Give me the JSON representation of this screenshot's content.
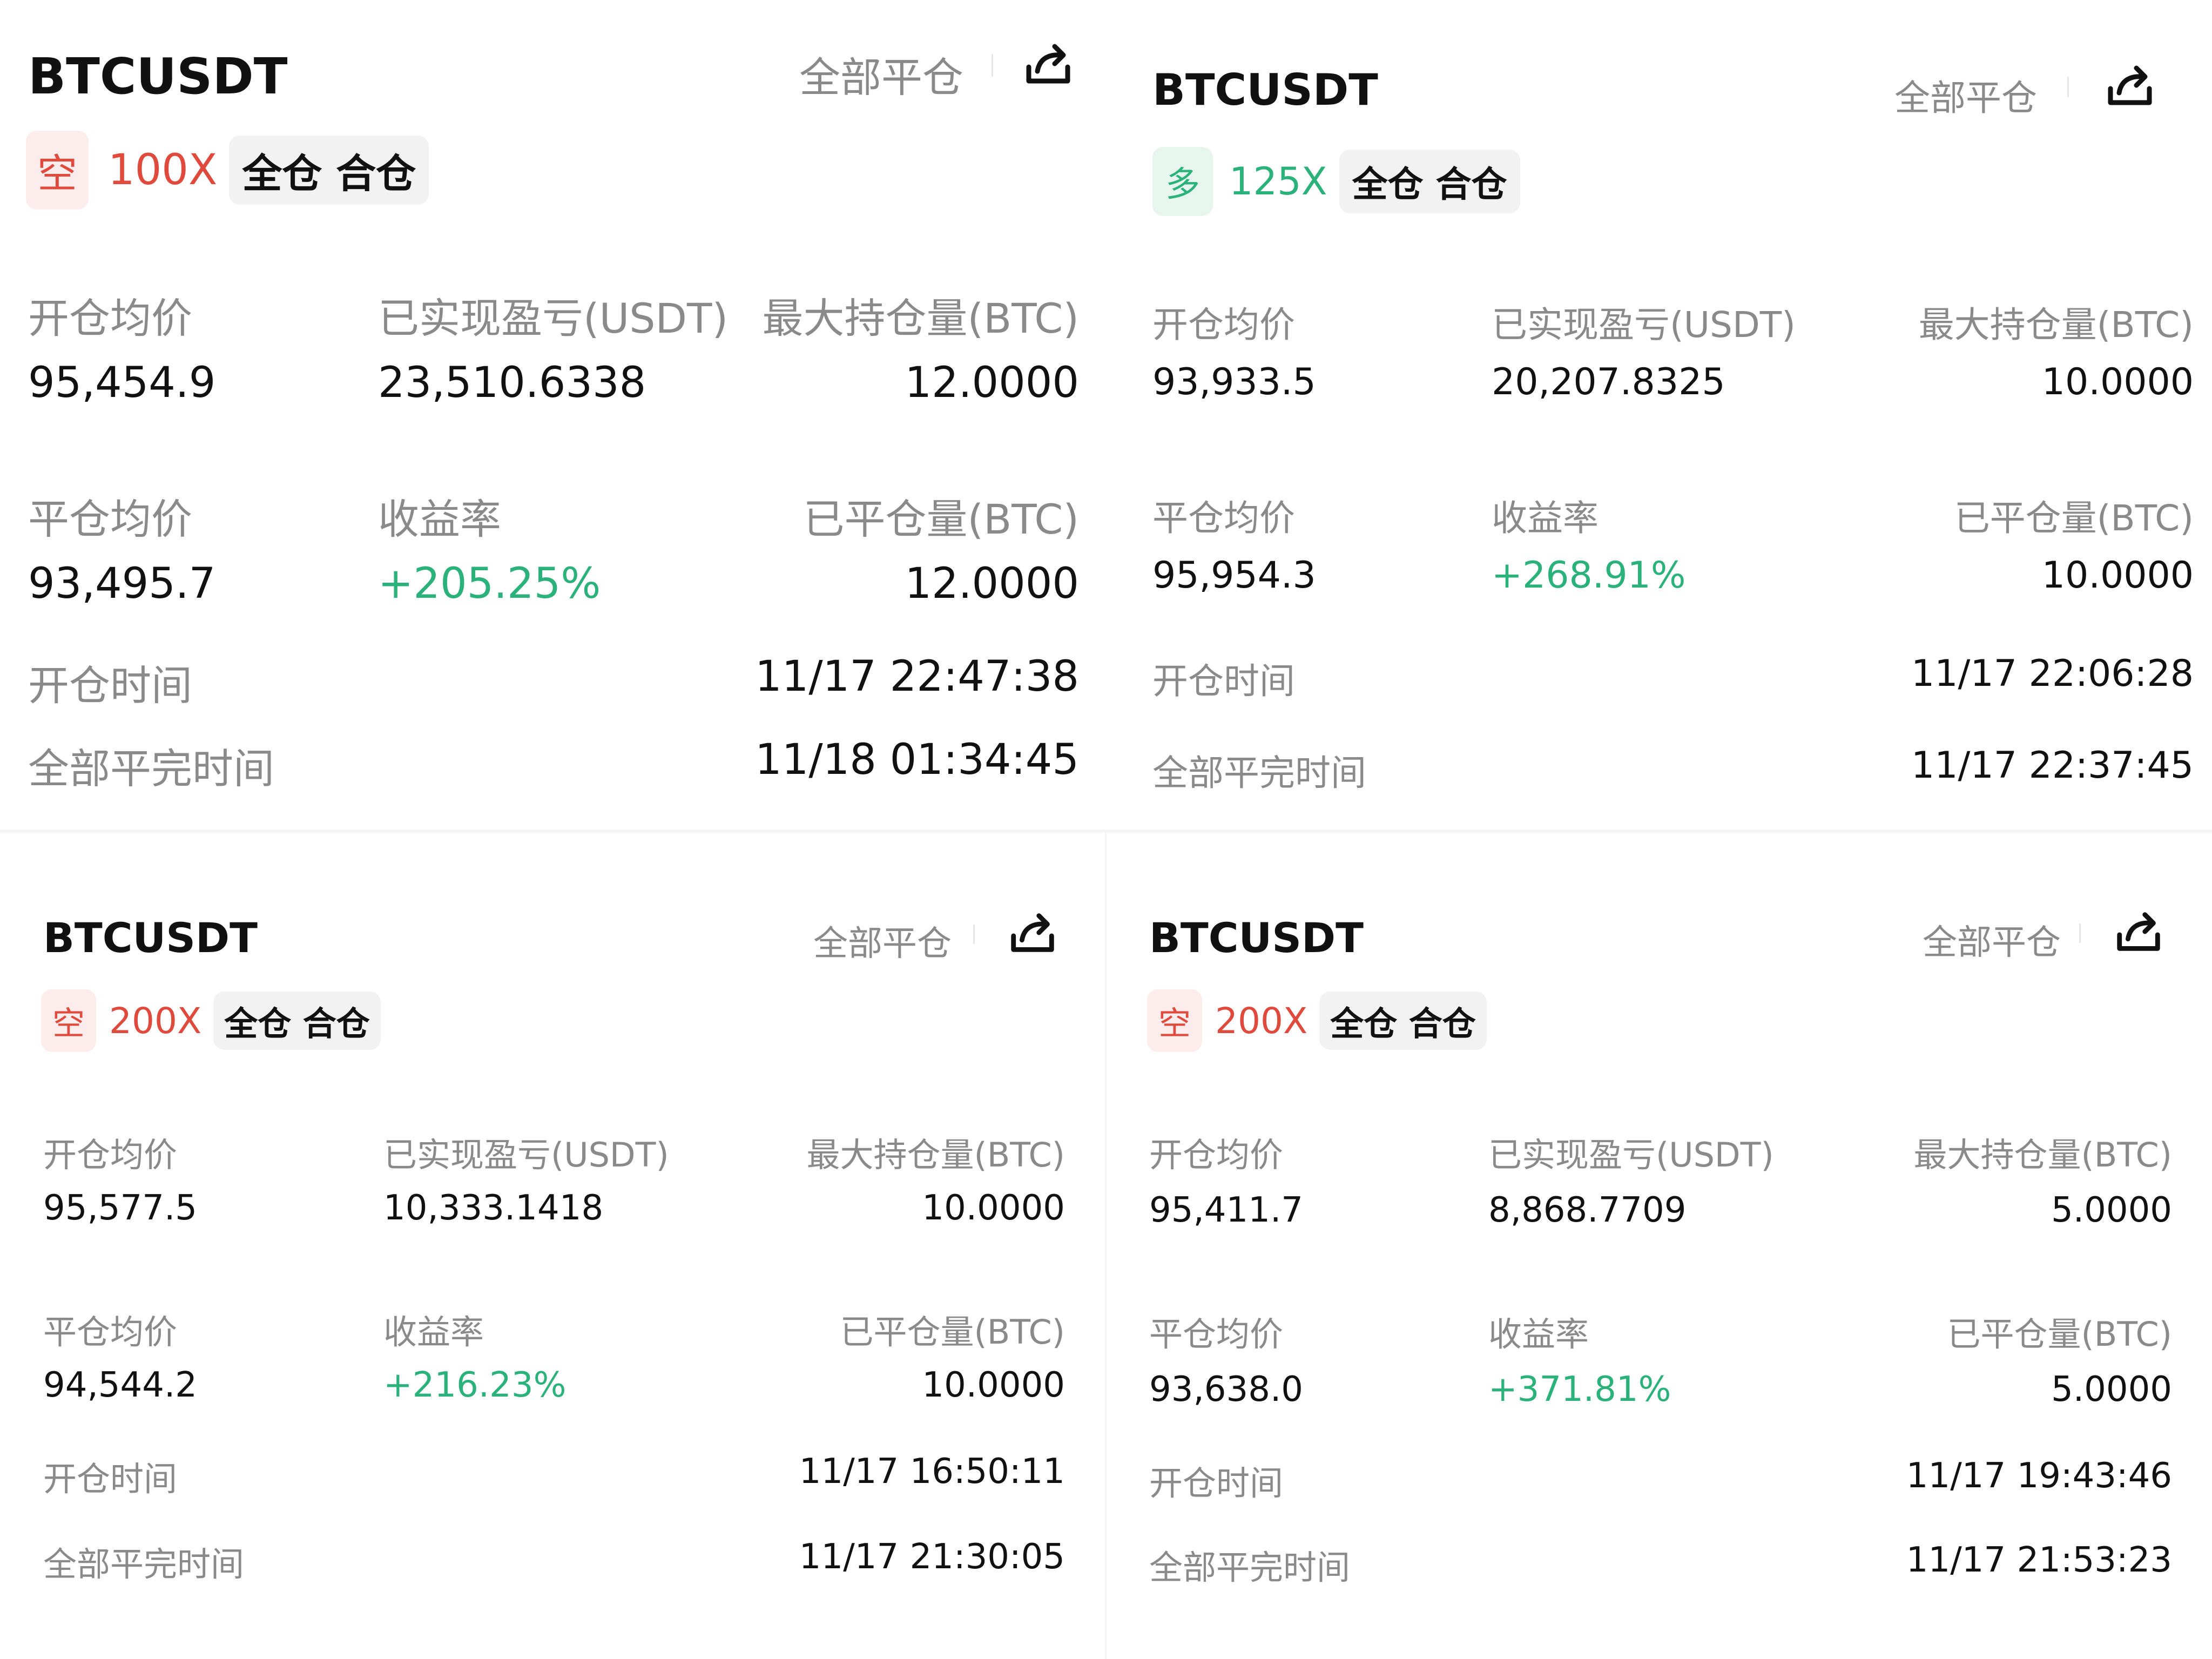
{
  "labels": {
    "open_avg": "开仓均价",
    "realized_pnl": "已实现盈亏(USDT)",
    "max_position": "最大持仓量(BTC)",
    "close_avg": "平仓均价",
    "yield": "收益率",
    "closed_qty": "已平仓量(BTC)",
    "open_time": "开仓时间",
    "full_close_time": "全部平完时间"
  },
  "cards": [
    {
      "symbol": "BTCUSDT",
      "close_all": "全部平仓",
      "side": "空",
      "side_type": "short",
      "leverage": "100X",
      "margin_mode": "全仓 合仓",
      "open_avg": "95,454.9",
      "realized_pnl": "23,510.6338",
      "max_position": "12.0000",
      "close_avg": "93,495.7",
      "yield": "+205.25%",
      "closed_qty": "12.0000",
      "open_time": "11/17 22:47:38",
      "full_close_time": "11/18 01:34:45"
    },
    {
      "symbol": "BTCUSDT",
      "close_all": "全部平仓",
      "side": "多",
      "side_type": "long",
      "leverage": "125X",
      "margin_mode": "全仓 合仓",
      "open_avg": "93,933.5",
      "realized_pnl": "20,207.8325",
      "max_position": "10.0000",
      "close_avg": "95,954.3",
      "yield": "+268.91%",
      "closed_qty": "10.0000",
      "open_time": "11/17 22:06:28",
      "full_close_time": "11/17 22:37:45"
    },
    {
      "symbol": "BTCUSDT",
      "close_all": "全部平仓",
      "side": "空",
      "side_type": "short",
      "leverage": "200X",
      "margin_mode": "全仓 合仓",
      "open_avg": "95,577.5",
      "realized_pnl": "10,333.1418",
      "max_position": "10.0000",
      "close_avg": "94,544.2",
      "yield": "+216.23%",
      "closed_qty": "10.0000",
      "open_time": "11/17 16:50:11",
      "full_close_time": "11/17 21:30:05"
    },
    {
      "symbol": "BTCUSDT",
      "close_all": "全部平仓",
      "side": "空",
      "side_type": "short",
      "leverage": "200X",
      "margin_mode": "全仓 合仓",
      "open_avg": "95,411.7",
      "realized_pnl": "8,868.7709",
      "max_position": "5.0000",
      "close_avg": "93,638.0",
      "yield": "+371.81%",
      "closed_qty": "5.0000",
      "open_time": "11/17 19:43:46",
      "full_close_time": "11/17 21:53:23"
    }
  ],
  "colors": {
    "short": "#e04a3c",
    "short_bg": "#fdecec",
    "long": "#2bb17a",
    "long_bg": "#e6f6ef",
    "profit": "#2bb17a",
    "label": "#8a8a8a",
    "text": "#111111"
  },
  "icons": {
    "share": "share-icon"
  }
}
